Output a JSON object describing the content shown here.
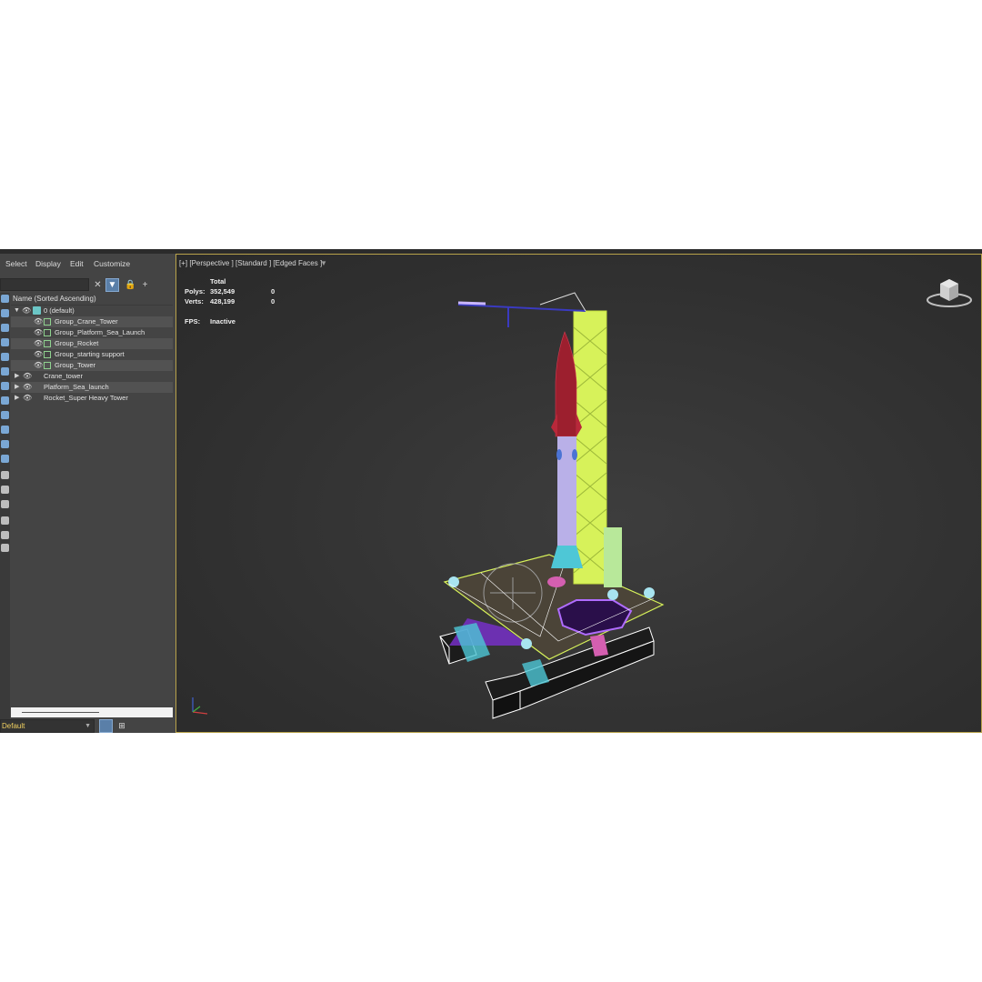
{
  "menu": [
    "Select",
    "Display",
    "Edit",
    "Customize"
  ],
  "explorer": {
    "column_header": "Name (Sorted Ascending)",
    "rows": [
      {
        "label": "0 (default)",
        "kind": "layer"
      },
      {
        "label": "Group_Crane_Tower",
        "kind": "group"
      },
      {
        "label": "Group_Platform_Sea_Launch",
        "kind": "group"
      },
      {
        "label": "Group_Rocket",
        "kind": "group"
      },
      {
        "label": "Group_starting support",
        "kind": "group"
      },
      {
        "label": "Group_Tower",
        "kind": "group"
      },
      {
        "label": "Crane_tower",
        "kind": "object"
      },
      {
        "label": "Platform_Sea_launch",
        "kind": "object"
      },
      {
        "label": "Rocket_Super Heavy Tower",
        "kind": "object"
      }
    ],
    "layer_select": "Default"
  },
  "viewport": {
    "label": "[+] [Perspective ] [Standard ] [Edged Faces ]",
    "stats": {
      "total_header": "Total",
      "polys_label": "Polys:",
      "polys_total": "352,549",
      "polys_selected": "0",
      "verts_label": "Verts:",
      "verts_total": "428,199",
      "verts_selected": "0",
      "fps_label": "FPS:",
      "fps_value": "Inactive"
    }
  },
  "colors": {
    "viewport_border": "#b8a24a",
    "selection_blue": "#5a7fa8",
    "rocket_red": "#9c1f2e",
    "rocket_body": "#b9b0e8",
    "tower_green": "#d7f25a",
    "platform_purple": "#7b2fd1",
    "platform_cyan": "#4ec7d6"
  }
}
